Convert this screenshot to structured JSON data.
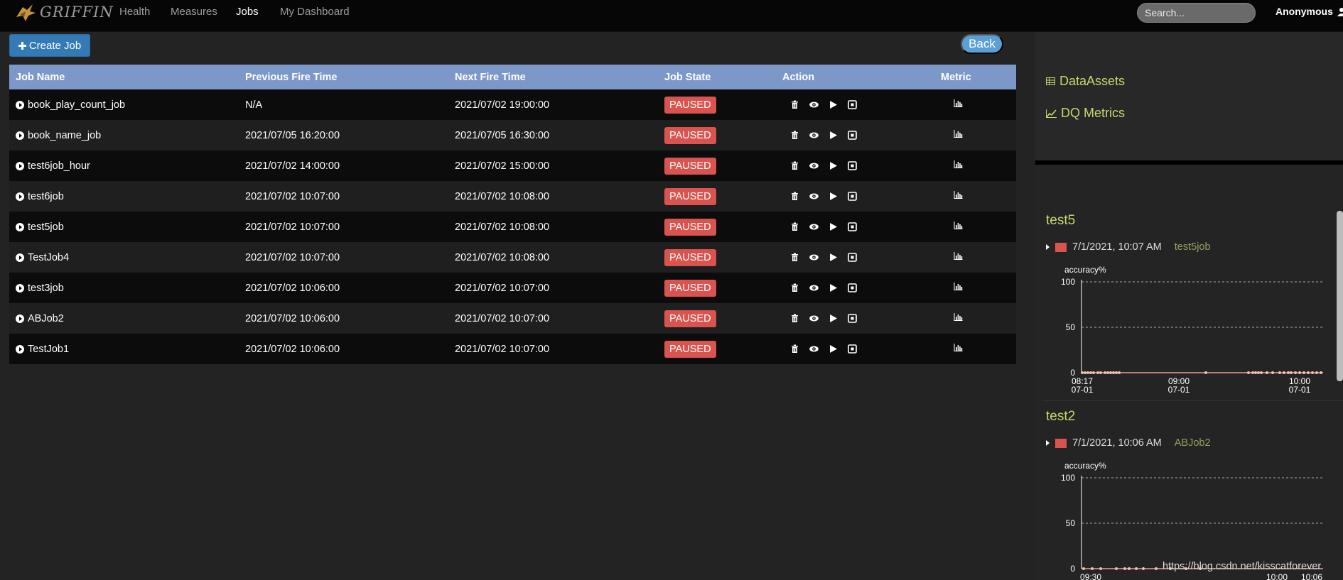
{
  "nav": {
    "logo_text": "GRIFFIN",
    "links": [
      "Health",
      "Measures",
      "Jobs",
      "My Dashboard"
    ],
    "active": "Jobs",
    "search_placeholder": "Search...",
    "user": "Anonymous"
  },
  "toolbar": {
    "create_label": "Create Job",
    "back_label": "Back"
  },
  "table": {
    "headers": [
      "Job Name",
      "Previous Fire Time",
      "Next Fire Time",
      "Job State",
      "Action",
      "Metric"
    ],
    "rows": [
      {
        "name": "book_play_count_job",
        "prev": "N/A",
        "next": "2021/07/02 19:00:00",
        "state": "PAUSED"
      },
      {
        "name": "book_name_job",
        "prev": "2021/07/05 16:20:00",
        "next": "2021/07/05 16:30:00",
        "state": "PAUSED"
      },
      {
        "name": "test6job_hour",
        "prev": "2021/07/02 14:00:00",
        "next": "2021/07/02 15:00:00",
        "state": "PAUSED"
      },
      {
        "name": "test6job",
        "prev": "2021/07/02 10:07:00",
        "next": "2021/07/02 10:08:00",
        "state": "PAUSED"
      },
      {
        "name": "test5job",
        "prev": "2021/07/02 10:07:00",
        "next": "2021/07/02 10:08:00",
        "state": "PAUSED"
      },
      {
        "name": "TestJob4",
        "prev": "2021/07/02 10:07:00",
        "next": "2021/07/02 10:08:00",
        "state": "PAUSED"
      },
      {
        "name": "test3job",
        "prev": "2021/07/02 10:06:00",
        "next": "2021/07/02 10:07:00",
        "state": "PAUSED"
      },
      {
        "name": "ABJob2",
        "prev": "2021/07/02 10:06:00",
        "next": "2021/07/02 10:07:00",
        "state": "PAUSED"
      },
      {
        "name": "TestJob1",
        "prev": "2021/07/02 10:06:00",
        "next": "2021/07/02 10:07:00",
        "state": "PAUSED"
      }
    ]
  },
  "sidebar": {
    "links": [
      "DataAssets",
      "DQ Metrics"
    ],
    "metrics": [
      {
        "title": "test5",
        "timestamp": "7/1/2021, 10:07 AM",
        "job": "test5job",
        "ylabel": "accuracy%",
        "yticks": [
          "100",
          "50",
          "0"
        ],
        "xticks": [
          {
            "time": "08:17",
            "date": "07-01"
          },
          {
            "time": "09:00",
            "date": "07-01"
          },
          {
            "time": "10:00",
            "date": "07-01"
          }
        ]
      },
      {
        "title": "test2",
        "timestamp": "7/1/2021, 10:06 AM",
        "job": "ABJob2",
        "ylabel": "accuracy%",
        "yticks": [
          "100",
          "50",
          "0"
        ],
        "xticks": [
          {
            "time": "09:30",
            "date": ""
          },
          {
            "time": "10:00",
            "date": ""
          },
          {
            "time": "10:06",
            "date": ""
          }
        ]
      }
    ]
  },
  "watermark": "https://blog.csdn.net/kisscatforever",
  "colors": {
    "accent": "#337ab7",
    "header": "#7c98c9",
    "paused": "#d9534f",
    "sidebar_link": "#c5d86d"
  }
}
